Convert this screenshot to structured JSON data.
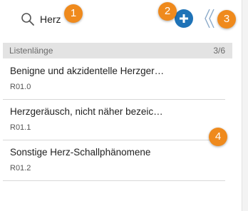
{
  "search": {
    "value": "Herz"
  },
  "list": {
    "header_title": "Listenlänge",
    "count": "3/6",
    "items": [
      {
        "name": "Benigne und akzidentelle Herzger…",
        "code": "R01.0"
      },
      {
        "name": "Herzgeräusch, nicht näher bezeic…",
        "code": "R01.1"
      },
      {
        "name": "Sonstige Herz-Schallphänomene",
        "code": "R01.2"
      }
    ]
  },
  "markers": [
    "1",
    "2",
    "3",
    "4"
  ],
  "colors": {
    "accent": "#1f73b7",
    "marker": "#ef8a1d",
    "header_bg": "#e3e3e3"
  },
  "icons": {
    "search": "search-icon",
    "add": "plus-icon",
    "collapse": "double-chevron-left-icon"
  }
}
